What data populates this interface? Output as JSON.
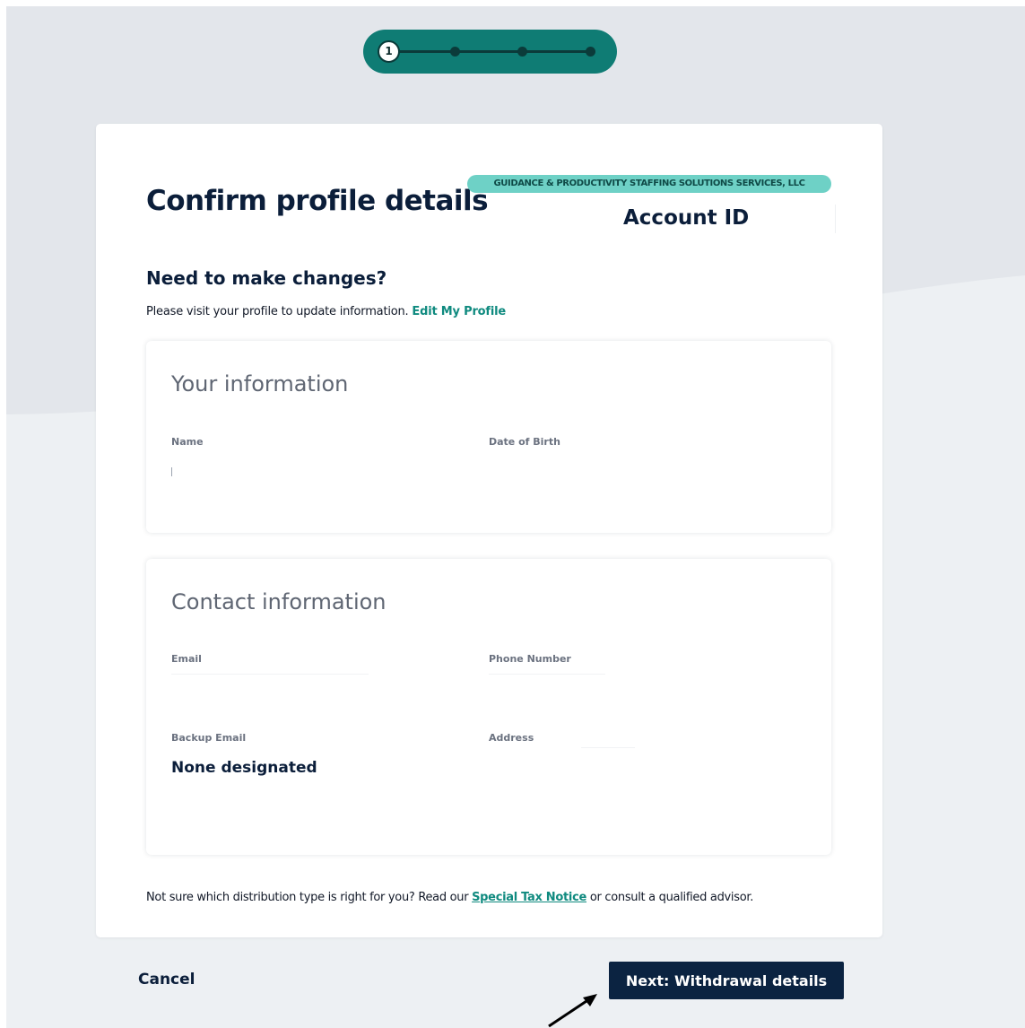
{
  "stepper": {
    "current_step": "1",
    "total_steps": 4
  },
  "card": {
    "title": "Confirm profile details",
    "company_badge": "GUIDANCE & PRODUCTIVITY STAFFING SOLUTIONS SERVICES, LLC",
    "account_id_label": "Account ID",
    "changes_heading": "Need to make changes?",
    "changes_text": "Please visit your profile to update information.",
    "edit_profile_link": "Edit My Profile",
    "your_information": {
      "title": "Your information",
      "name_label": "Name",
      "dob_label": "Date of Birth"
    },
    "contact_information": {
      "title": "Contact information",
      "email_label": "Email",
      "phone_label": "Phone Number",
      "backup_email_label": "Backup Email",
      "backup_email_value": "None designated",
      "address_label": "Address"
    },
    "tax_note": {
      "before": "Not sure which distribution type is right for you? Read our",
      "link": "Special Tax Notice",
      "after": "or consult a qualified advisor."
    }
  },
  "footer": {
    "cancel_label": "Cancel",
    "next_label": "Next: Withdrawal details"
  },
  "colors": {
    "teal_accent": "#0f7c74",
    "badge_teal": "#6ed1c6",
    "link_teal": "#0f8a7f",
    "navy": "#0b2341",
    "background": "#edf0f3"
  }
}
